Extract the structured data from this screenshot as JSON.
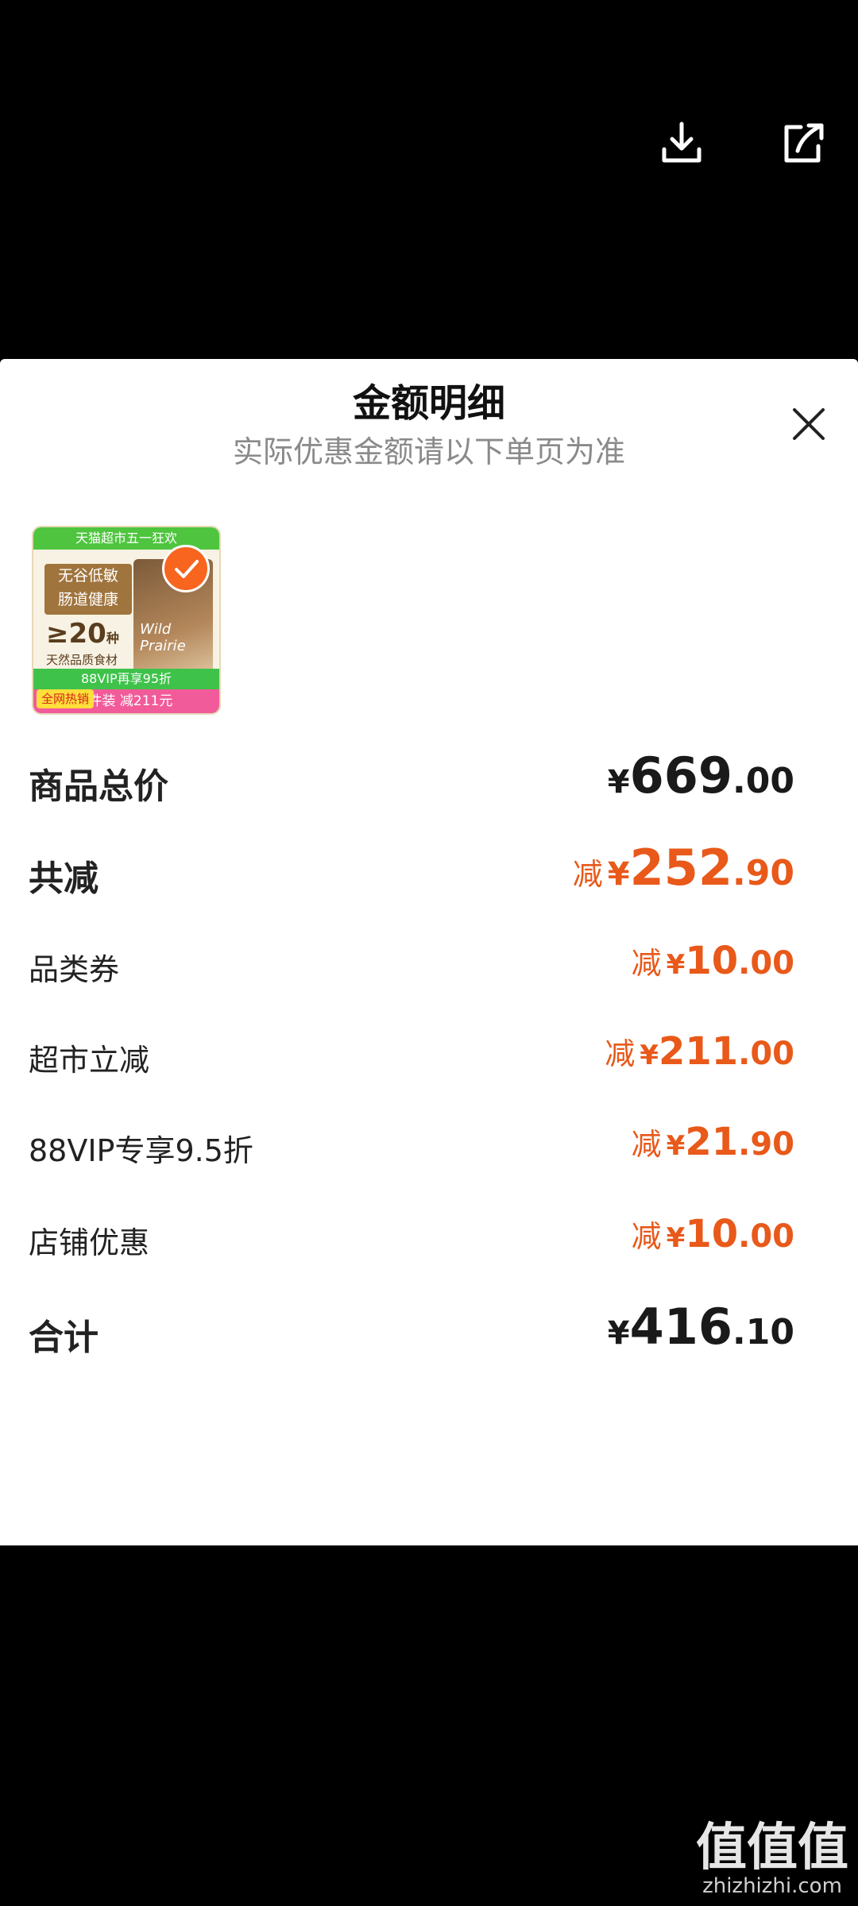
{
  "top_icons": {
    "download": "download-icon",
    "share": "share-icon"
  },
  "sheet": {
    "title": "金额明细",
    "subtitle": "实际优惠金额请以下单页为准",
    "close_icon": "close-icon"
  },
  "product": {
    "banner": "天猫超市五一狂欢",
    "badge_line1": "无谷低敏",
    "badge_line2": "肠道健康",
    "stat": "≥20",
    "stat_unit": "种",
    "stat_sub": "天然品质食材",
    "bag_label": "Wild Prairie",
    "vip_strip": "88VIP再享95折",
    "promo_strip": "1件装 减211元",
    "hot_tag": "全网热销"
  },
  "rows": [
    {
      "label": "商品总价",
      "prefix": "",
      "yen": "¥",
      "int": "669",
      "dec": ".00"
    },
    {
      "label": "共减",
      "prefix": "减",
      "yen": "¥",
      "int": "252",
      "dec": ".90"
    },
    {
      "label": "品类券",
      "prefix": "减",
      "yen": "¥",
      "int": "10",
      "dec": ".00"
    },
    {
      "label": "超市立减",
      "prefix": "减",
      "yen": "¥",
      "int": "211",
      "dec": ".00"
    },
    {
      "label": "88VIP专享9.5折",
      "prefix": "减",
      "yen": "¥",
      "int": "21",
      "dec": ".90"
    },
    {
      "label": "店铺优惠",
      "prefix": "减",
      "yen": "¥",
      "int": "10",
      "dec": ".00"
    },
    {
      "label": "合计",
      "prefix": "",
      "yen": "¥",
      "int": "416",
      "dec": ".10"
    }
  ],
  "watermark": {
    "big": "值值值",
    "small": "zhizhizhi.com"
  },
  "colors": {
    "accent": "#e8591a",
    "subtitle": "#8a8a8a",
    "check": "#f7651f"
  }
}
